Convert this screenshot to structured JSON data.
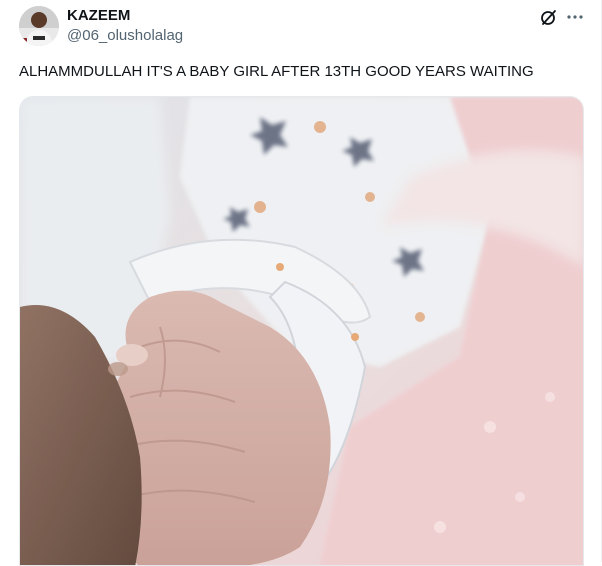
{
  "author": {
    "name": "KAZEEM",
    "handle": "@06_olusholalag"
  },
  "tweet": {
    "text": "ALHAMMDULLAH IT'S A BABY GIRL AFTER 13TH GOOD YEARS WAITING"
  },
  "actions": {
    "grok_icon": "grok-icon",
    "more_icon": "more-icon"
  },
  "colors": {
    "text_primary": "#0f1419",
    "text_secondary": "#536471",
    "blanket_pink": "#efc9c9"
  }
}
